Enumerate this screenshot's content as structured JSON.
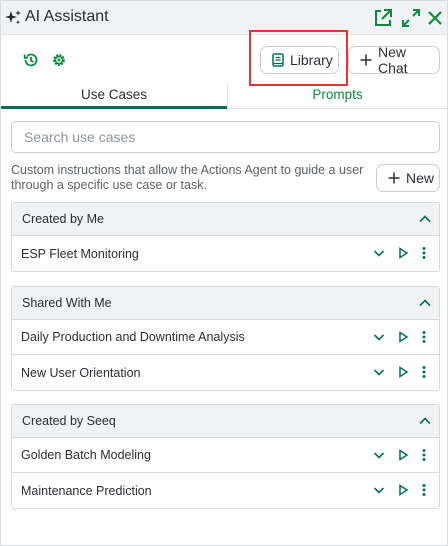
{
  "header": {
    "title": "AI Assistant",
    "icons": [
      "sparkle-icon",
      "open-external-icon",
      "expand-icon",
      "close-icon"
    ]
  },
  "toolbar": {
    "history_icon": "history-icon",
    "settings_icon": "gear-icon",
    "library_label": "Library",
    "new_chat_label": "New Chat"
  },
  "tabs": [
    {
      "label": "Use Cases",
      "active": true
    },
    {
      "label": "Prompts",
      "active": false
    }
  ],
  "search": {
    "placeholder": "Search use cases",
    "value": ""
  },
  "description": "Custom instructions that allow the Actions Agent to guide a user through a specific use case or task.",
  "new_button_label": "New",
  "sections": [
    {
      "title": "Created by Me",
      "items": [
        "ESP Fleet Monitoring"
      ]
    },
    {
      "title": "Shared With Me",
      "items": [
        "Daily Production and Downtime Analysis",
        "New User Orientation"
      ]
    },
    {
      "title": "Created by Seeq",
      "items": [
        "Golden Batch Modeling",
        "Maintenance Prediction"
      ]
    }
  ],
  "colors": {
    "accent_green": "#0a8a3c",
    "tab_underline": "#0a6b5e",
    "highlight_red": "#e8323c"
  }
}
